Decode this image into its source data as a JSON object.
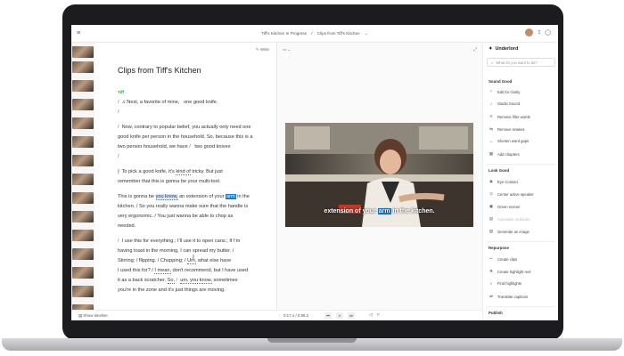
{
  "topbar": {
    "menu_icon": "hamburger-icon",
    "project": "Tiff's Kitchen In Progress",
    "separator": "/",
    "document": "Clips from Tiff's Kitchen",
    "chevron": "⌄"
  },
  "toolbar": {
    "write_label": "Write"
  },
  "document": {
    "title": "Clips from Tiff's Kitchen",
    "speaker": "Tiff"
  },
  "script": {
    "l1_a": "♫ Next, a favorite of mine,",
    "l1_b": "one good knife.",
    "l3_a": "Now, contrary to popular belief, you actually only need one",
    "l4": "good knife per person in the household. So, because this is a",
    "l5_a": "two person household, we have",
    "l5_b": "two good knives",
    "l7_a": "To pick a good knife, it's",
    "l7_b": "kind of",
    "l7_c": "tricky. But just",
    "l8": "remember that this is gonna be your multi-tool.",
    "l10_a": "This is gonna be",
    "l10_b": "you know,",
    "l10_c": "an extension of your",
    "l10_d": "arm",
    "l10_e": "in the",
    "l11": "kitchen.  /  So you really wanna make sure that the handle is",
    "l12": "very ergonomic.  /  You just wanna be able to chop as",
    "l13": "needed.",
    "l15_a": "I use this for everything.",
    "l15_b": ";  I'll use it to open cans.",
    "l15_c": ";  If I'm",
    "l16": "having toast in the morning, I can spread my butter.  /",
    "l17_a": "Stirring;  /  flipping.  /  Chopping;  /",
    "l17_b": "Um,",
    "l17_c": "what else have",
    "l18_a": "I used this for?  /",
    "l18_b": "I mean,",
    "l18_c": "don't recommend, but I have used",
    "l19_a": "it as a back scratcher.",
    "l19_b": "So,",
    "l19_c": "um, you know,",
    "l19_d": "sometimes",
    "l20": "you're in the zone and it's just things are moving.",
    "slash": "/"
  },
  "video": {
    "caption_a": "extension of your",
    "caption_b": "arm",
    "caption_c": "in the kitchen."
  },
  "transport": {
    "show_timeline": "Show timeline",
    "current": "0:17.4",
    "sep": "/",
    "total": "0:58.2"
  },
  "sidebar": {
    "title": "Underlord",
    "search_placeholder": "What do you want to do?",
    "sections": [
      {
        "label": "Sound Good",
        "items": [
          "Edit for clarity",
          "Studio Sound",
          "Remove filler words",
          "Remove retakes",
          "Shorten word gaps",
          "Add chapters"
        ]
      },
      {
        "label": "Look Good",
        "items": [
          "Eye Contact",
          "Center active speaker",
          "Green screen",
          "Automatic multicam",
          "Generate an image"
        ]
      },
      {
        "label": "Repurpose",
        "items": [
          "Create clips",
          "Create highlight reel",
          "Find highlights",
          "Translate captions"
        ]
      },
      {
        "label": "Publish",
        "items": []
      }
    ]
  },
  "colors": {
    "accent": "#1f7cd6",
    "speaker": "#2d9b3a",
    "highlight": "#d5e8fb"
  }
}
